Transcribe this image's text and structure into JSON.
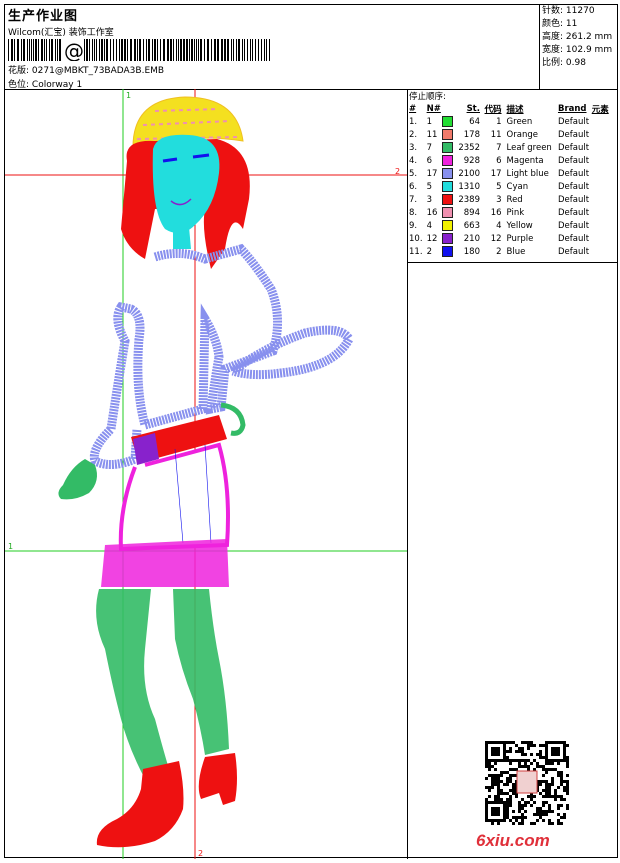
{
  "header": {
    "title": "生产作业图",
    "company": "Wilcom(汇宝) 装饰工作室",
    "design_label": "花版:",
    "design_file": "0271@MBKT_73BADA3B.EMB",
    "colorway_label": "色位:",
    "colorway": "Colorway 1"
  },
  "stats": [
    {
      "label": "针数:",
      "value": "11270"
    },
    {
      "label": "颜色:",
      "value": "11"
    },
    {
      "label": "高度:",
      "value": "261.2 mm"
    },
    {
      "label": "宽度:",
      "value": "102.9 mm"
    },
    {
      "label": "比例:",
      "value": "0.98"
    }
  ],
  "stop_sequence": {
    "title": "停止顺序:",
    "columns": [
      "#",
      "N#",
      "St.",
      "代码",
      "描述",
      "Brand",
      "元素"
    ],
    "rows": [
      {
        "idx": "1.",
        "n": "1",
        "color": "#22dd33",
        "st": "64",
        "code": "1",
        "desc": "Green",
        "brand": "Default"
      },
      {
        "idx": "2.",
        "n": "11",
        "color": "#f07a6a",
        "st": "178",
        "code": "11",
        "desc": "Orange",
        "brand": "Default"
      },
      {
        "idx": "3.",
        "n": "7",
        "color": "#33bb66",
        "st": "2352",
        "code": "7",
        "desc": "Leaf green",
        "brand": "Default"
      },
      {
        "idx": "4.",
        "n": "6",
        "color": "#ee22dd",
        "st": "928",
        "code": "6",
        "desc": "Magenta",
        "brand": "Default"
      },
      {
        "idx": "5.",
        "n": "17",
        "color": "#8890ee",
        "st": "2100",
        "code": "17",
        "desc": "Light blue",
        "brand": "Default"
      },
      {
        "idx": "6.",
        "n": "5",
        "color": "#22dddd",
        "st": "1310",
        "code": "5",
        "desc": "Cyan",
        "brand": "Default"
      },
      {
        "idx": "7.",
        "n": "3",
        "color": "#ee1111",
        "st": "2389",
        "code": "3",
        "desc": "Red",
        "brand": "Default"
      },
      {
        "idx": "8.",
        "n": "16",
        "color": "#f090b0",
        "st": "894",
        "code": "16",
        "desc": "Pink",
        "brand": "Default"
      },
      {
        "idx": "9.",
        "n": "4",
        "color": "#f0f000",
        "st": "663",
        "code": "4",
        "desc": "Yellow",
        "brand": "Default"
      },
      {
        "idx": "10.",
        "n": "12",
        "color": "#8822cc",
        "st": "210",
        "code": "12",
        "desc": "Purple",
        "brand": "Default"
      },
      {
        "idx": "11.",
        "n": "2",
        "color": "#1111ee",
        "st": "180",
        "code": "2",
        "desc": "Blue",
        "brand": "Default"
      }
    ]
  },
  "guides": {
    "v1": "1",
    "h2": "2",
    "h1": "1",
    "v2": "2"
  },
  "watermark": "6xiu.com"
}
